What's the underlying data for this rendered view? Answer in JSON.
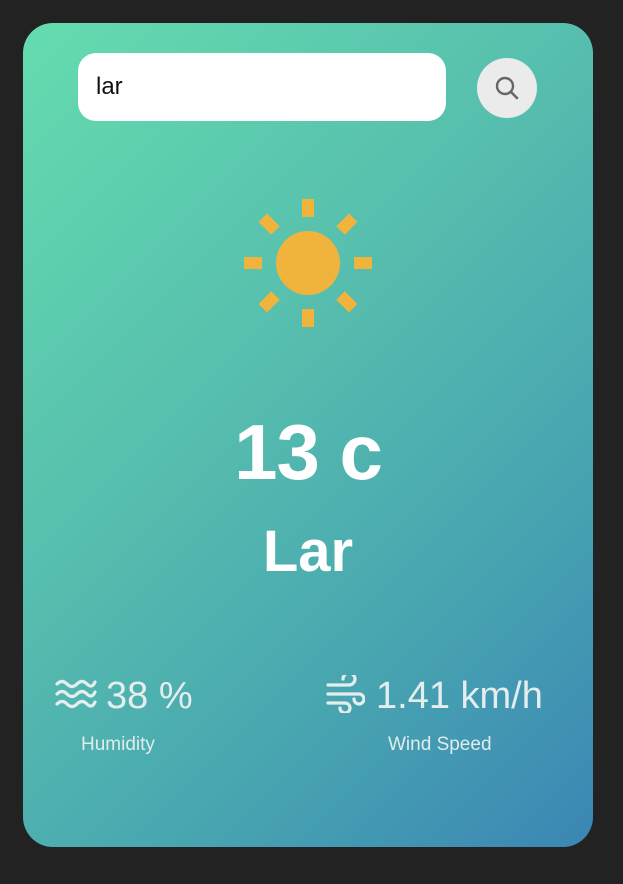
{
  "search": {
    "value": "lar",
    "button_icon": "search-icon"
  },
  "weather": {
    "icon": "sun-icon",
    "temperature": "13 c",
    "city": "Lar"
  },
  "humidity": {
    "icon": "humidity-waves-icon",
    "value": "38 %",
    "label": "Humidity"
  },
  "wind": {
    "icon": "wind-icon",
    "value": "1.41 km/h",
    "label": "Wind Speed"
  },
  "colors": {
    "background": "#222222",
    "card_gradient_start": "#65dcaf",
    "card_gradient_end": "#3b86b5",
    "sun": "#f0b43c"
  }
}
